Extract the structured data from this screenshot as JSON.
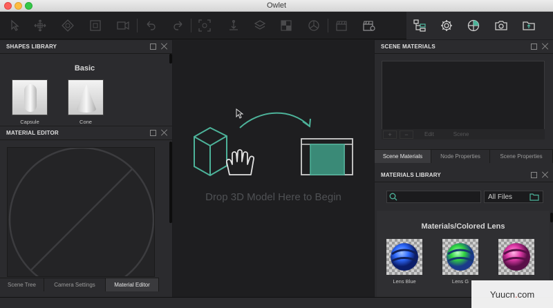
{
  "window": {
    "title": "Owlet"
  },
  "panels": {
    "shapes_library": {
      "title": "SHAPES LIBRARY",
      "section": "Basic",
      "items": [
        {
          "label": "Capsule"
        },
        {
          "label": "Cone"
        }
      ]
    },
    "material_editor": {
      "title": "MATERIAL EDITOR"
    },
    "left_tabs": [
      {
        "label": "Scene Tree",
        "active": false
      },
      {
        "label": "Camera Settings",
        "active": false
      },
      {
        "label": "Material Editor",
        "active": true
      }
    ],
    "viewport": {
      "drop_text": "Drop 3D Model Here to Begin"
    },
    "scene_materials": {
      "title": "SCENE MATERIALS",
      "footer": {
        "add": "+",
        "remove": "−",
        "edit": "Edit",
        "scene": "Scene"
      },
      "tabs": [
        {
          "label": "Scene Materials",
          "active": true
        },
        {
          "label": "Node Properties",
          "active": false
        },
        {
          "label": "Scene Properties",
          "active": false
        }
      ]
    },
    "materials_library": {
      "title": "MATERIALS LIBRARY",
      "search_placeholder": "",
      "filter_value": "All Files",
      "section": "Materials/Colored Lens",
      "items": [
        {
          "label": "Lens Blue",
          "color": "#2f6bff"
        },
        {
          "label": "Lens G",
          "color": "#2fd53f"
        },
        {
          "label": "",
          "color": "#e03aa8"
        }
      ]
    }
  },
  "watermark": {
    "text_pre": "Yuucn",
    "text_dot": ".",
    "text_post": "com"
  },
  "colors": {
    "accent": "#4db39a",
    "panel": "#2b2b2e",
    "viewport": "#1e1e20"
  }
}
